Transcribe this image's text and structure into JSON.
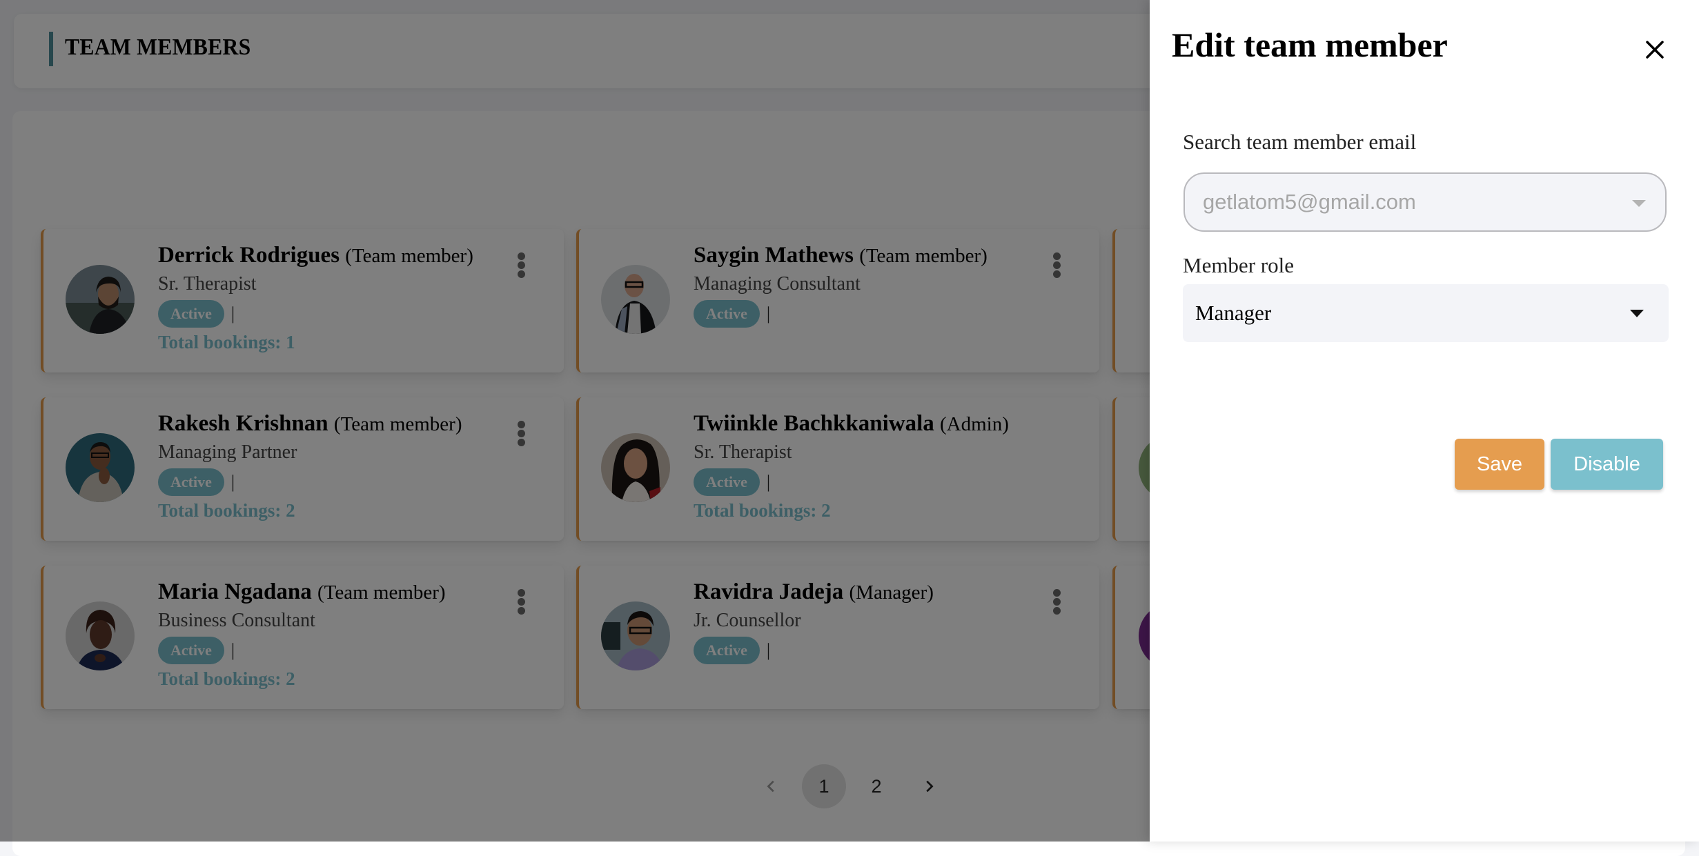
{
  "header": {
    "title": "TEAM MEMBERS"
  },
  "colors": {
    "accent_teal": "#7bbfcc",
    "card_border_orange": "#e59a4a",
    "save_button": "#e59d4f",
    "disable_button": "#7bc0cd"
  },
  "members": [
    {
      "name": "Derrick Rodrigues",
      "role": "(Team member)",
      "title": "Sr. Therapist",
      "status": "Active",
      "separator": "|",
      "bookings": "Total bookings: 1",
      "has_menu": true,
      "avatar": "bearded-man-photo"
    },
    {
      "name": "Saygin Mathews",
      "role": "(Team member)",
      "title": "Managing Consultant",
      "status": "Active",
      "separator": "|",
      "bookings": "",
      "has_menu": true,
      "avatar": "man-glasses-blazer-photo"
    },
    {
      "name": "",
      "role": "",
      "title": "",
      "status": "",
      "separator": "",
      "bookings": "",
      "has_menu": false,
      "avatar": "dark-avatar-partial"
    },
    {
      "name": "Rakesh Krishnan",
      "role": "(Team member)",
      "title": "Managing Partner",
      "status": "Active",
      "separator": "|",
      "bookings": "Total bookings: 2",
      "has_menu": true,
      "avatar": "smiling-man-photo"
    },
    {
      "name": "Twiinkle Bachkkaniwala",
      "role": "(Admin)",
      "title": "Sr. Therapist",
      "status": "Active",
      "separator": "|",
      "bookings": "Total bookings: 2",
      "has_menu": false,
      "avatar": "woman-dark-hair-photo"
    },
    {
      "name": "",
      "role": "",
      "title": "",
      "status": "",
      "separator": "",
      "bookings": "",
      "has_menu": false,
      "avatar": "green-avatar-partial"
    },
    {
      "name": "Maria Ngadana",
      "role": "(Team member)",
      "title": "Business Consultant",
      "status": "Active",
      "separator": "|",
      "bookings": "Total bookings: 2",
      "has_menu": true,
      "avatar": "woman-short-hair-photo"
    },
    {
      "name": "Ravidra Jadeja",
      "role": "(Manager)",
      "title": "Jr. Counsellor",
      "status": "Active",
      "separator": "|",
      "bookings": "",
      "has_menu": true,
      "avatar": "man-glasses-smiling-photo"
    },
    {
      "name": "",
      "role": "",
      "title": "",
      "status": "",
      "separator": "",
      "bookings": "",
      "has_menu": false,
      "avatar": "purple-avatar-partial"
    }
  ],
  "pagination": {
    "prev": "previous-page",
    "pages": [
      "1",
      "2"
    ],
    "current": "1",
    "next": "next-page"
  },
  "drawer": {
    "title": "Edit team member",
    "email_label": "Search team member email",
    "email_value": "getlatom5@gmail.com",
    "role_label": "Member role",
    "role_value": "Manager",
    "save_label": "Save",
    "disable_label": "Disable"
  }
}
